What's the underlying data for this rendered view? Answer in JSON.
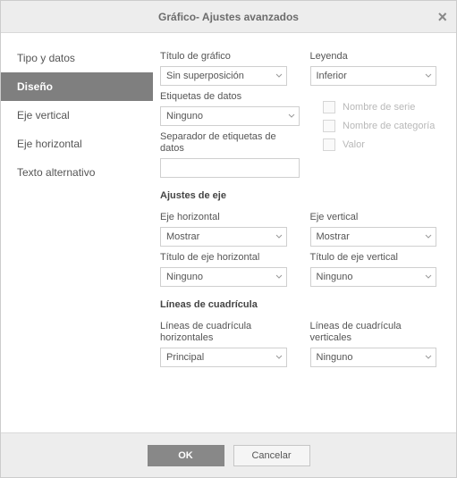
{
  "title": "Gráfico- Ajustes avanzados",
  "sidebar": {
    "items": [
      {
        "label": "Tipo y datos"
      },
      {
        "label": "Diseño"
      },
      {
        "label": "Eje vertical"
      },
      {
        "label": "Eje horizontal"
      },
      {
        "label": "Texto alternativo"
      }
    ],
    "activeIndex": 1
  },
  "fields": {
    "chartTitle": {
      "label": "Título de gráfico",
      "value": "Sin superposición"
    },
    "legend": {
      "label": "Leyenda",
      "value": "Inferior"
    },
    "dataLabels": {
      "label": "Etiquetas de datos",
      "value": "Ninguno"
    },
    "dataLabelSep": {
      "label": "Separador de etiquetas de datos",
      "value": ""
    },
    "axisSection": "Ajustes de eje",
    "hAxis": {
      "label": "Eje horizontal",
      "value": "Mostrar"
    },
    "vAxis": {
      "label": "Eje vertical",
      "value": "Mostrar"
    },
    "hAxisTitle": {
      "label": "Título de eje horizontal",
      "value": "Ninguno"
    },
    "vAxisTitle": {
      "label": "Título de eje vertical",
      "value": "Ninguno"
    },
    "gridSection": "Líneas de cuadrícula",
    "hGrid": {
      "label": "Líneas de cuadrícula horizontales",
      "value": "Principal"
    },
    "vGrid": {
      "label": "Líneas de cuadrícula verticales",
      "value": "Ninguno"
    }
  },
  "checks": {
    "seriesName": "Nombre de serie",
    "categoryName": "Nombre de categoría",
    "value": "Valor"
  },
  "buttons": {
    "ok": "OK",
    "cancel": "Cancelar"
  }
}
